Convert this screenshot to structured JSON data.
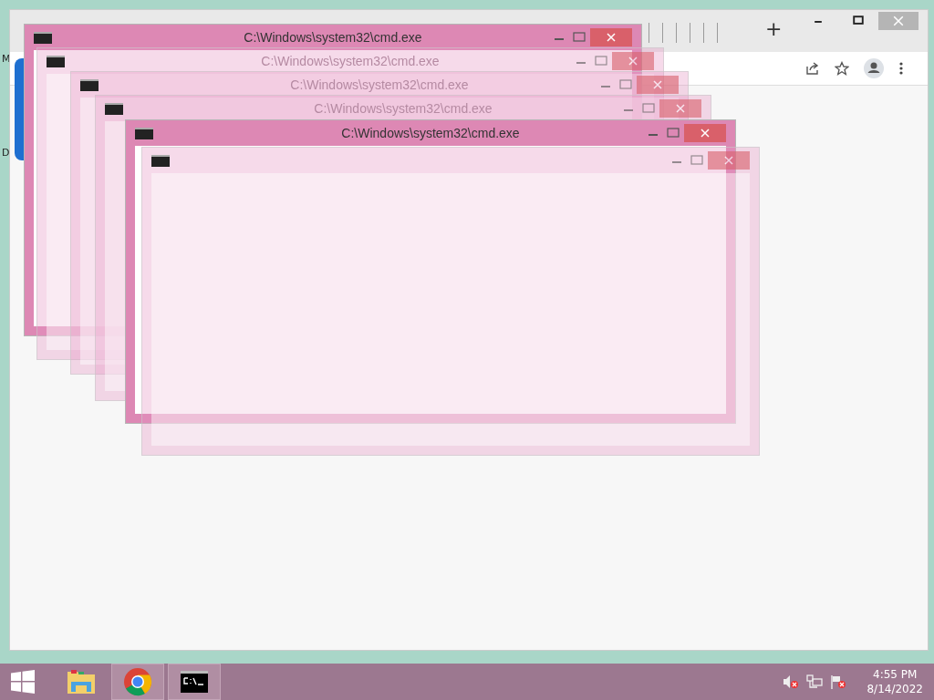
{
  "desktop": {
    "icon_labels": [
      "M",
      "D"
    ]
  },
  "browser": {
    "new_tab": "+"
  },
  "cmd_windows": [
    {
      "title": "C:\\Windows\\system32\\cmd.exe",
      "faded": false
    },
    {
      "title": "C:\\Windows\\system32\\cmd.exe",
      "faded": true
    },
    {
      "title": "C:\\Windows\\system32\\cmd.exe",
      "faded": true
    },
    {
      "title": "C:\\Windows\\system32\\cmd.exe",
      "faded": true
    },
    {
      "title": "C:\\Windows\\system32\\cmd.exe",
      "faded": false
    },
    {
      "faded": true
    }
  ],
  "taskbar": {
    "apps": [
      {
        "kind": "explorer",
        "selected": false
      },
      {
        "kind": "chrome",
        "selected": true
      },
      {
        "kind": "cmd",
        "selected": true
      }
    ],
    "time": "4:55 PM",
    "date": "8/14/2022"
  }
}
